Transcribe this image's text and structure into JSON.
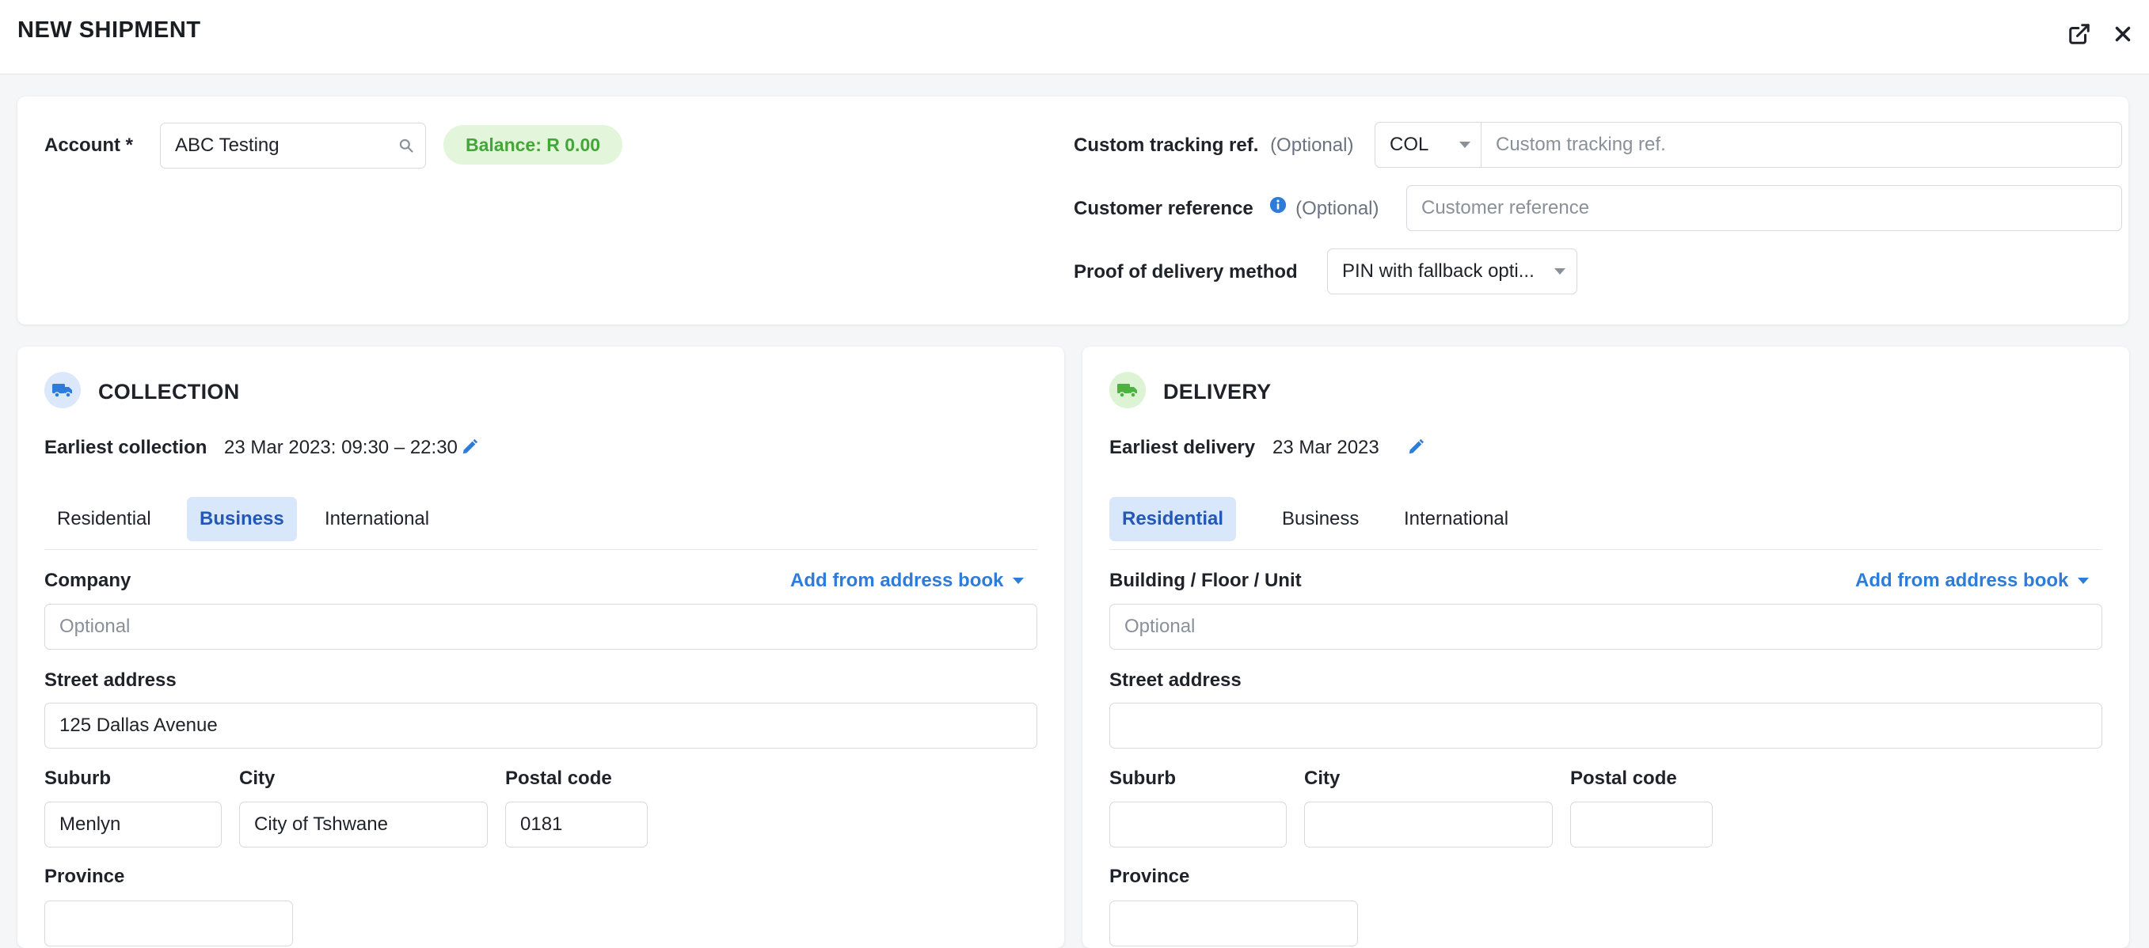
{
  "header": {
    "title": "NEW SHIPMENT",
    "icons": [
      "external-link-icon",
      "close-icon"
    ]
  },
  "account": {
    "label": "Account *",
    "value": "ABC Testing",
    "balance": "Balance: R 0.00"
  },
  "tracking": {
    "label": "Custom tracking ref.",
    "optional": "(Optional)",
    "prefix": "COL",
    "placeholder": "Custom tracking ref."
  },
  "customer_ref": {
    "label": "Customer reference",
    "optional": "(Optional)",
    "placeholder": "Customer reference"
  },
  "pod": {
    "label": "Proof of delivery method",
    "value": "PIN with fallback opti..."
  },
  "collection": {
    "title": "COLLECTION",
    "earliest_label": "Earliest collection",
    "earliest_value": "23 Mar 2023: 09:30 – 22:30",
    "tabs": [
      "Residential",
      "Business",
      "International"
    ],
    "active_tab": "Business",
    "first_field_label": "Company",
    "add_link": "Add from address book",
    "first_field_placeholder": "Optional",
    "street_label": "Street address",
    "street_value": "125 Dallas Avenue",
    "suburb_label": "Suburb",
    "suburb_value": "Menlyn",
    "city_label": "City",
    "city_value": "City of Tshwane",
    "postal_label": "Postal code",
    "postal_value": "0181",
    "province_label": "Province"
  },
  "delivery": {
    "title": "DELIVERY",
    "earliest_label": "Earliest delivery",
    "earliest_value": "23 Mar 2023",
    "tabs": [
      "Residential",
      "Business",
      "International"
    ],
    "active_tab": "Residential",
    "first_field_label": "Building / Floor / Unit",
    "add_link": "Add from address book",
    "first_field_placeholder": "Optional",
    "street_label": "Street address",
    "street_value": "",
    "suburb_label": "Suburb",
    "suburb_value": "",
    "city_label": "City",
    "city_value": "",
    "postal_label": "Postal code",
    "postal_value": "",
    "province_label": "Province"
  },
  "colors": {
    "accent": "#2e7cd9",
    "tab_active_bg": "#d9e7fb",
    "balance_bg": "#e3f6dc",
    "balance_text": "#44a637",
    "collection_icon_bg": "#dbe8fb",
    "delivery_icon_bg": "#dcf3d4"
  }
}
